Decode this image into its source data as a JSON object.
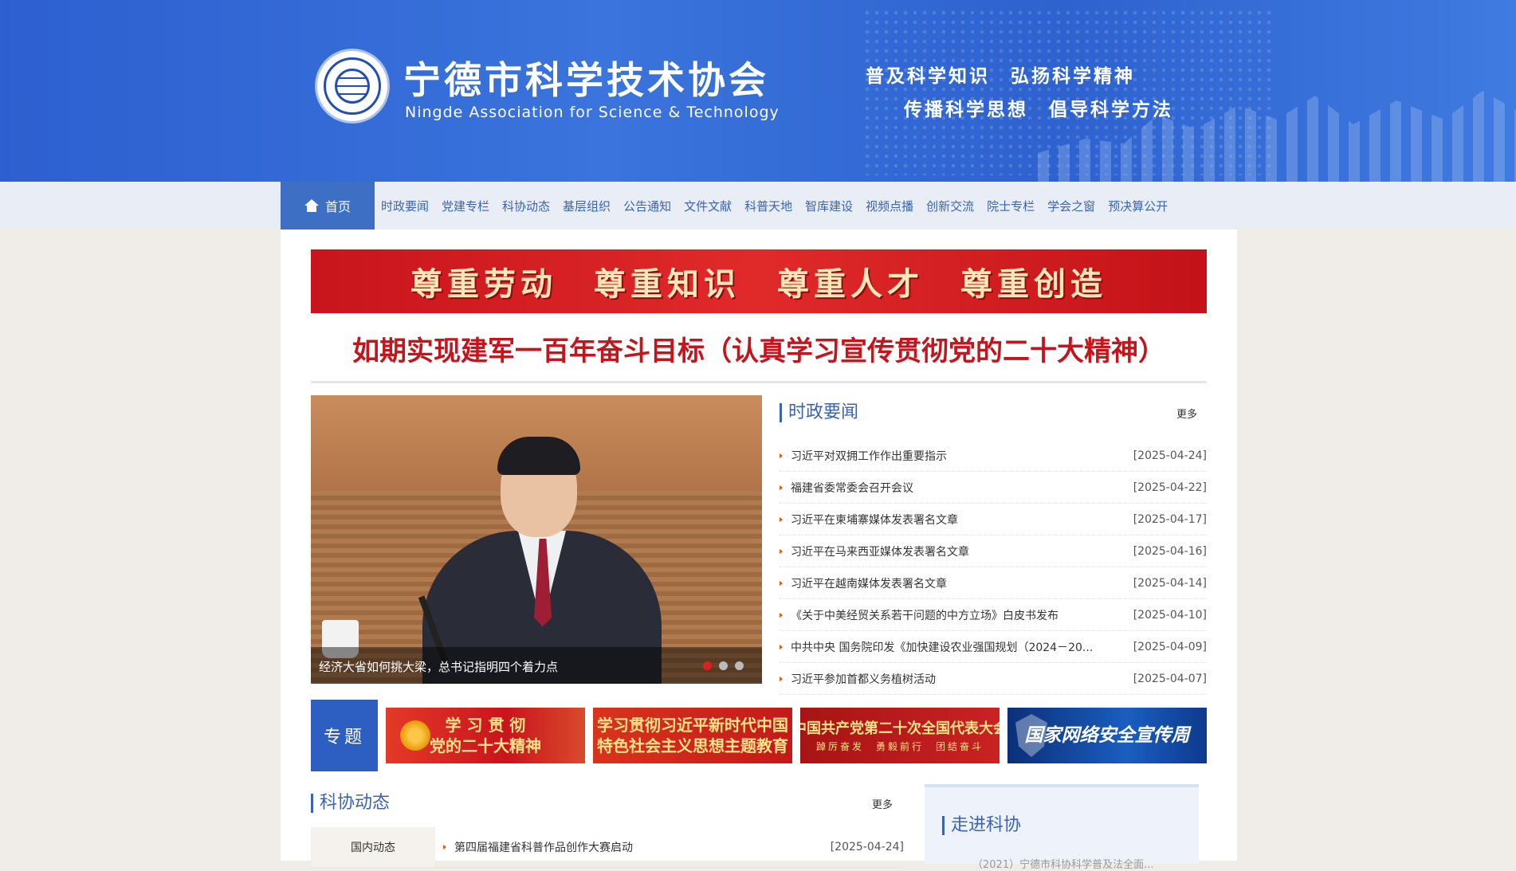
{
  "header": {
    "title": "宁德市科学技术协会",
    "subtitle": "Ningde Association for Science & Technology",
    "slogan_line1": "普及科学知识　弘扬科学精神",
    "slogan_line2": "传播科学思想　倡导科学方法",
    "colors": {
      "header_bg": "#2d5fd0",
      "nav_bg": "#e9eef6",
      "accent": "#3d6fc4"
    }
  },
  "nav": {
    "home_label": "首页",
    "home_icon": "home-icon",
    "items": [
      "时政要闻",
      "党建专栏",
      "科协动态",
      "基层组织",
      "公告通知",
      "文件文献",
      "科普天地",
      "智库建设",
      "视频点播",
      "创新交流",
      "院士专栏",
      "学会之窗",
      "预决算公开"
    ]
  },
  "banner": {
    "text": "尊重劳动　尊重知识　尊重人才　尊重创造",
    "color": "#d91e24"
  },
  "headline": "如期实现建军一百年奋斗目标（认真学习宣传贯彻党的二十大精神）",
  "slider": {
    "caption": "经济大省如何挑大梁，总书记指明四个着力点",
    "active_dot": 1,
    "dot_count": 3
  },
  "news": {
    "title": "时政要闻",
    "more": "更多",
    "items": [
      {
        "title": "习近平对双拥工作作出重要指示",
        "date": "[2025-04-24]"
      },
      {
        "title": "福建省委常委会召开会议",
        "date": "[2025-04-22]"
      },
      {
        "title": "习近平在柬埔寨媒体发表署名文章",
        "date": "[2025-04-17]"
      },
      {
        "title": "习近平在马来西亚媒体发表署名文章",
        "date": "[2025-04-16]"
      },
      {
        "title": "习近平在越南媒体发表署名文章",
        "date": "[2025-04-14]"
      },
      {
        "title": "《关于中美经贸关系若干问题的中方立场》白皮书发布",
        "date": "[2025-04-10]"
      },
      {
        "title": "中共中央 国务院印发《加快建设农业强国规划（2024－20...",
        "date": "[2025-04-09]"
      },
      {
        "title": "习近平参加首都义务植树活动",
        "date": "[2025-04-07]"
      }
    ]
  },
  "topics": {
    "label": "专题",
    "items": [
      {
        "line1": "学 习 贯 彻",
        "line2": "党的二十大精神",
        "sub": ""
      },
      {
        "line1": "学习贯彻习近平新时代中国",
        "line2": "特色社会主义思想主题教育",
        "sub": ""
      },
      {
        "line1": "中国共产党第二十次全国代表大会",
        "line2": "",
        "sub": "踔厉奋发　勇毅前行　团结奋斗"
      },
      {
        "line1": "国家网络安全宣传周",
        "line2": "",
        "sub": ""
      }
    ]
  },
  "kexie": {
    "title": "科协动态",
    "more": "更多",
    "tab": "国内动态",
    "item": "第四届福建省科普作品创作大赛启动",
    "date": "[2025-04-24]"
  },
  "zoujin": {
    "title": "走进科协",
    "preview": "（2021）宁德市科协科学普及法全面..."
  }
}
